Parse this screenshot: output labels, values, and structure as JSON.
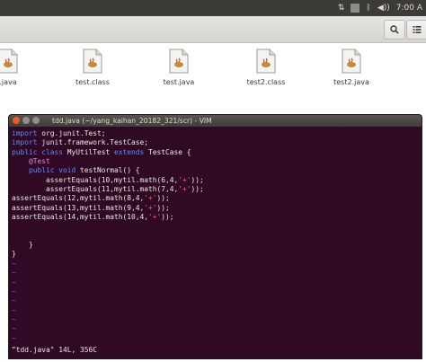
{
  "tray": {
    "network_icon": "network-arrows-icon",
    "keyboard_icon": "keyboard-layout-icon",
    "bluetooth_icon": "bluetooth-icon",
    "volume_icon": "volume-icon",
    "clock": "7:00 A"
  },
  "toolbar": {
    "search_icon": "search-icon",
    "view_icon": "list-view-icon"
  },
  "files": [
    {
      "name": ".java"
    },
    {
      "name": "test.class"
    },
    {
      "name": "test.java"
    },
    {
      "name": "test2.class"
    },
    {
      "name": "test2.java"
    }
  ],
  "vim": {
    "title": "tdd.java (~/yang_kaihan_20182_321/scr) - VIM",
    "code": [
      {
        "segs": [
          {
            "t": "import",
            "c": "kw"
          },
          {
            "t": " org.junit.Test;",
            "c": ""
          }
        ]
      },
      {
        "segs": [
          {
            "t": "import",
            "c": "kw"
          },
          {
            "t": " junit.framework.TestCase;",
            "c": ""
          }
        ]
      },
      {
        "segs": [
          {
            "t": "public class",
            "c": "kw"
          },
          {
            "t": " MyUtilTest ",
            "c": ""
          },
          {
            "t": "extends",
            "c": "kw"
          },
          {
            "t": " TestCase {",
            "c": ""
          }
        ]
      },
      {
        "segs": [
          {
            "t": "    @Test",
            "c": "ann"
          }
        ]
      },
      {
        "segs": [
          {
            "t": "    public void",
            "c": "kw"
          },
          {
            "t": " testNormal() {",
            "c": ""
          }
        ]
      },
      {
        "segs": [
          {
            "t": "        assertEquals(10,mytil.math(6,4,",
            "c": ""
          },
          {
            "t": "'+'",
            "c": "str"
          },
          {
            "t": "));",
            "c": ""
          }
        ]
      },
      {
        "segs": [
          {
            "t": "        assertEquals(11,mytil.math(7,4,",
            "c": ""
          },
          {
            "t": "'+'",
            "c": "str"
          },
          {
            "t": "));",
            "c": ""
          }
        ]
      },
      {
        "segs": [
          {
            "t": "assertEquals(12,mytil.math(8,4,",
            "c": ""
          },
          {
            "t": "'+'",
            "c": "str"
          },
          {
            "t": "));",
            "c": ""
          }
        ]
      },
      {
        "segs": [
          {
            "t": "assertEquals(13,mytil.math(9,4,",
            "c": ""
          },
          {
            "t": "'+'",
            "c": "str"
          },
          {
            "t": "));",
            "c": ""
          }
        ]
      },
      {
        "segs": [
          {
            "t": "assertEquals(14,mytil.math(10,4,",
            "c": ""
          },
          {
            "t": "'+'",
            "c": "str"
          },
          {
            "t": "));",
            "c": ""
          }
        ]
      },
      {
        "segs": []
      },
      {
        "segs": []
      },
      {
        "segs": [
          {
            "t": "    }",
            "c": ""
          }
        ]
      },
      {
        "segs": [
          {
            "t": "}",
            "c": ""
          }
        ]
      },
      {
        "segs": [
          {
            "t": "~",
            "c": "tilde"
          }
        ]
      },
      {
        "segs": [
          {
            "t": "~",
            "c": "tilde"
          }
        ]
      },
      {
        "segs": [
          {
            "t": "~",
            "c": "tilde"
          }
        ]
      },
      {
        "segs": [
          {
            "t": "~",
            "c": "tilde"
          }
        ]
      },
      {
        "segs": [
          {
            "t": "~",
            "c": "tilde"
          }
        ]
      },
      {
        "segs": [
          {
            "t": "~",
            "c": "tilde"
          }
        ]
      },
      {
        "segs": [
          {
            "t": "~",
            "c": "tilde"
          }
        ]
      },
      {
        "segs": [
          {
            "t": "~",
            "c": "tilde"
          }
        ]
      },
      {
        "segs": [
          {
            "t": "~",
            "c": "tilde"
          }
        ]
      },
      {
        "segs": [
          {
            "t": "~",
            "c": "tilde"
          }
        ]
      }
    ],
    "status": "\"tdd.java\" 14L, 356C"
  }
}
